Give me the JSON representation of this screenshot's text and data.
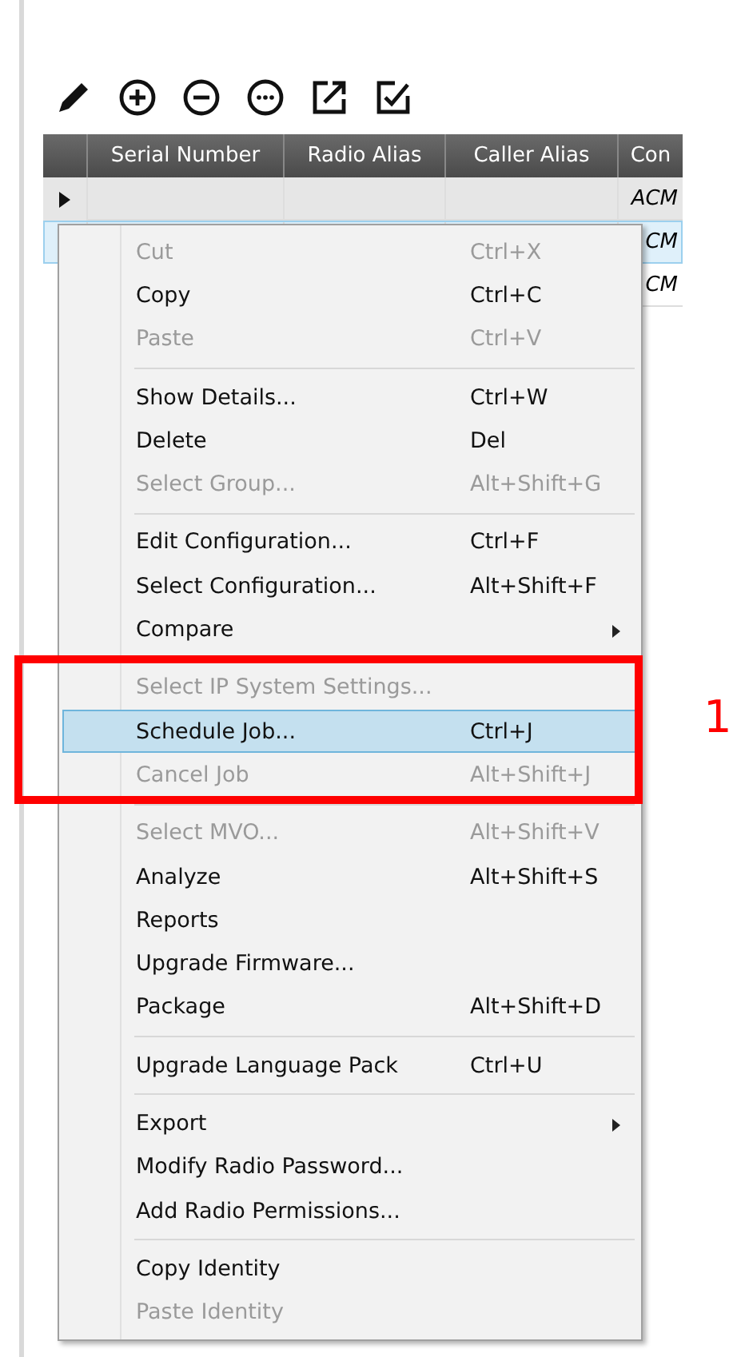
{
  "table": {
    "columns": [
      "Serial Number",
      "Radio Alias",
      "Caller Alias",
      "Con"
    ],
    "rows": [
      {
        "cells": [
          "",
          "",
          "",
          "ACM"
        ],
        "selected": false,
        "current": true
      },
      {
        "cells": [
          "",
          "",
          "",
          "CM"
        ],
        "selected": true,
        "current": false
      },
      {
        "cells": [
          "",
          "",
          "",
          "CM"
        ],
        "selected": false,
        "current": false
      }
    ]
  },
  "context_menu": {
    "items": [
      {
        "kind": "item",
        "label": "Cut",
        "shortcut": "Ctrl+X",
        "disabled": true,
        "selected": false,
        "submenu": false
      },
      {
        "kind": "item",
        "label": "Copy",
        "shortcut": "Ctrl+C",
        "disabled": false,
        "selected": false,
        "submenu": false
      },
      {
        "kind": "item",
        "label": "Paste",
        "shortcut": "Ctrl+V",
        "disabled": true,
        "selected": false,
        "submenu": false
      },
      {
        "kind": "separator"
      },
      {
        "kind": "item",
        "label": "Show Details...",
        "shortcut": "Ctrl+W",
        "disabled": false,
        "selected": false,
        "submenu": false
      },
      {
        "kind": "item",
        "label": "Delete",
        "shortcut": "Del",
        "disabled": false,
        "selected": false,
        "submenu": false
      },
      {
        "kind": "item",
        "label": "Select Group...",
        "shortcut": "Alt+Shift+G",
        "disabled": true,
        "selected": false,
        "submenu": false
      },
      {
        "kind": "separator"
      },
      {
        "kind": "item",
        "label": "Edit Configuration...",
        "shortcut": "Ctrl+F",
        "disabled": false,
        "selected": false,
        "submenu": false
      },
      {
        "kind": "item",
        "label": "Select Configuration...",
        "shortcut": "Alt+Shift+F",
        "disabled": false,
        "selected": false,
        "submenu": false
      },
      {
        "kind": "item",
        "label": "Compare",
        "disabled": false,
        "selected": false,
        "submenu": true
      },
      {
        "kind": "separator"
      },
      {
        "kind": "item",
        "label": "Select IP System Settings...",
        "disabled": true,
        "selected": false,
        "submenu": false
      },
      {
        "kind": "item",
        "label": "Schedule Job...",
        "shortcut": "Ctrl+J",
        "disabled": false,
        "selected": true,
        "submenu": false
      },
      {
        "kind": "item",
        "label": "Cancel Job",
        "shortcut": "Alt+Shift+J",
        "disabled": true,
        "selected": false,
        "submenu": false
      },
      {
        "kind": "separator"
      },
      {
        "kind": "item",
        "label": "Select MVO...",
        "shortcut": "Alt+Shift+V",
        "disabled": true,
        "selected": false,
        "submenu": false
      },
      {
        "kind": "item",
        "label": "Analyze",
        "shortcut": "Alt+Shift+S",
        "disabled": false,
        "selected": false,
        "submenu": false
      },
      {
        "kind": "item",
        "label": "Reports",
        "disabled": false,
        "selected": false,
        "submenu": false
      },
      {
        "kind": "item",
        "label": "Upgrade Firmware...",
        "disabled": false,
        "selected": false,
        "submenu": false
      },
      {
        "kind": "item",
        "label": "Package",
        "shortcut": "Alt+Shift+D",
        "disabled": false,
        "selected": false,
        "submenu": false
      },
      {
        "kind": "separator"
      },
      {
        "kind": "item",
        "label": "Upgrade Language Pack",
        "shortcut": "Ctrl+U",
        "disabled": false,
        "selected": false,
        "submenu": false
      },
      {
        "kind": "separator"
      },
      {
        "kind": "item",
        "label": "Export",
        "disabled": false,
        "selected": false,
        "submenu": true
      },
      {
        "kind": "item",
        "label": "Modify Radio Password...",
        "disabled": false,
        "selected": false,
        "submenu": false
      },
      {
        "kind": "item",
        "label": "Add Radio Permissions...",
        "disabled": false,
        "selected": false,
        "submenu": false
      },
      {
        "kind": "separator"
      },
      {
        "kind": "item",
        "label": "Copy Identity",
        "disabled": false,
        "selected": false,
        "submenu": false
      },
      {
        "kind": "item",
        "label": "Paste Identity",
        "disabled": true,
        "selected": false,
        "submenu": false
      }
    ]
  },
  "callout": {
    "label": "1"
  }
}
